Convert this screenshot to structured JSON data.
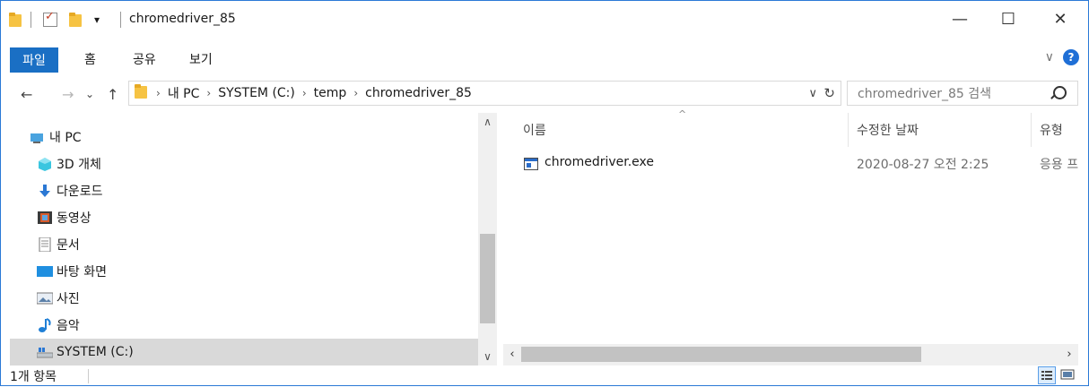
{
  "window": {
    "title": "chromedriver_85"
  },
  "title_controls": {
    "minimize": "—",
    "maximize": "☐",
    "close": "✕"
  },
  "ribbon": {
    "tabs": [
      "파일",
      "홈",
      "공유",
      "보기"
    ],
    "expand_icon": "∨",
    "help_label": "?"
  },
  "nav": {
    "back": "←",
    "forward": "→",
    "recent": "⌄",
    "up": "↑"
  },
  "address": {
    "breadcrumb": [
      "내 PC",
      "SYSTEM (C:)",
      "temp",
      "chromedriver_85"
    ],
    "separator": "›",
    "dropdown": "∨",
    "refresh": "↻"
  },
  "search": {
    "placeholder": "chromedriver_85 검색"
  },
  "sidebar": {
    "items": [
      {
        "label": "내 PC",
        "icon": "pc-icon"
      },
      {
        "label": "3D 개체",
        "icon": "3d-objects-icon"
      },
      {
        "label": "다운로드",
        "icon": "download-icon"
      },
      {
        "label": "동영상",
        "icon": "video-icon"
      },
      {
        "label": "문서",
        "icon": "document-icon"
      },
      {
        "label": "바탕 화면",
        "icon": "desktop-icon"
      },
      {
        "label": "사진",
        "icon": "pictures-icon"
      },
      {
        "label": "음악",
        "icon": "music-icon"
      },
      {
        "label": "SYSTEM (C:)",
        "icon": "drive-icon",
        "selected": true
      }
    ],
    "scroll_up": "∧",
    "scroll_down": "∨"
  },
  "file_list": {
    "columns": [
      "이름",
      "수정한 날짜",
      "유형"
    ],
    "sort_indicator": "^",
    "rows": [
      {
        "name": "chromedriver.exe",
        "modified": "2020-08-27 오전 2:25",
        "type": "응용 프"
      }
    ],
    "scroll_left": "‹",
    "scroll_right": "›"
  },
  "status": {
    "item_count": "1개 항목"
  }
}
